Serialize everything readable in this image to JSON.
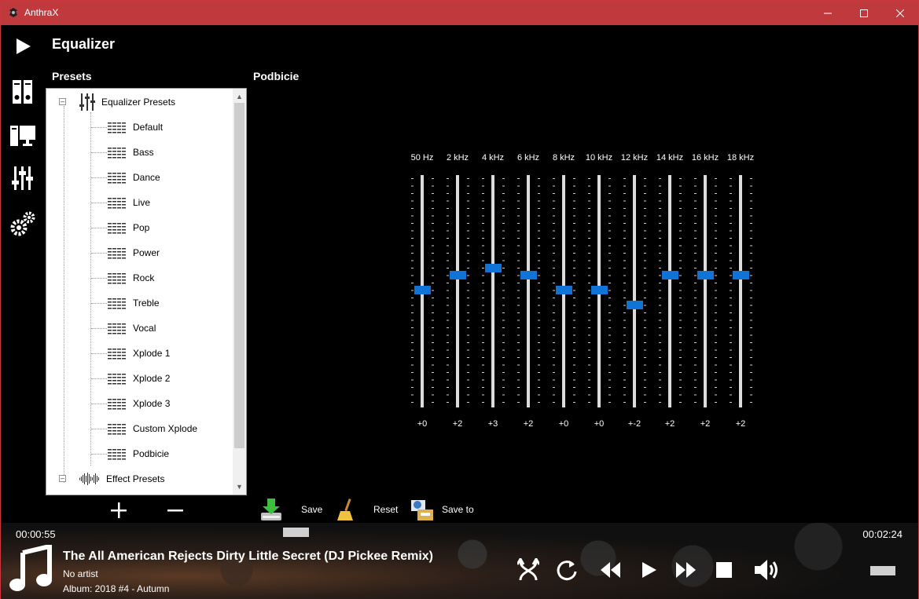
{
  "window": {
    "title": "AnthraX"
  },
  "page": {
    "title": "Equalizer",
    "presets_label": "Presets",
    "current_preset": "Podbicie"
  },
  "tree": {
    "groups": [
      {
        "label": "Equalizer Presets",
        "icon": "equalizer-sliders-icon",
        "items": [
          "Default",
          "Bass",
          "Dance",
          "Live",
          "Pop",
          "Power",
          "Rock",
          "Treble",
          "Vocal",
          "Xplode 1",
          "Xplode 2",
          "Xplode 3",
          "Custom Xplode",
          "Podbicie"
        ]
      },
      {
        "label": "Effect Presets",
        "icon": "waveform-icon",
        "items": []
      }
    ]
  },
  "tools": {
    "add": "+",
    "remove": "−",
    "save": "Save",
    "reset": "Reset",
    "save_to": "Save to"
  },
  "equalizer": {
    "bands": [
      {
        "freq": "50 Hz",
        "value": "+0",
        "level": 0
      },
      {
        "freq": "2 kHz",
        "value": "+2",
        "level": 2
      },
      {
        "freq": "4 kHz",
        "value": "+3",
        "level": 3
      },
      {
        "freq": "6 kHz",
        "value": "+2",
        "level": 2
      },
      {
        "freq": "8 kHz",
        "value": "+0",
        "level": 0
      },
      {
        "freq": "10 kHz",
        "value": "+0",
        "level": 0
      },
      {
        "freq": "12 kHz",
        "value": "+-2",
        "level": -2
      },
      {
        "freq": "14 kHz",
        "value": "+2",
        "level": 2
      },
      {
        "freq": "16 kHz",
        "value": "+2",
        "level": 2
      },
      {
        "freq": "18 kHz",
        "value": "+2",
        "level": 2
      }
    ]
  },
  "player": {
    "position": "00:00:55",
    "duration": "00:02:24",
    "title": "The All American Rejects  Dirty Little Secret (DJ Pickee Remix)",
    "artist": "No artist",
    "album": "Album: 2018 #4 - Autumn",
    "accent": "#1173d6",
    "titlebar_color": "#c0393d"
  }
}
